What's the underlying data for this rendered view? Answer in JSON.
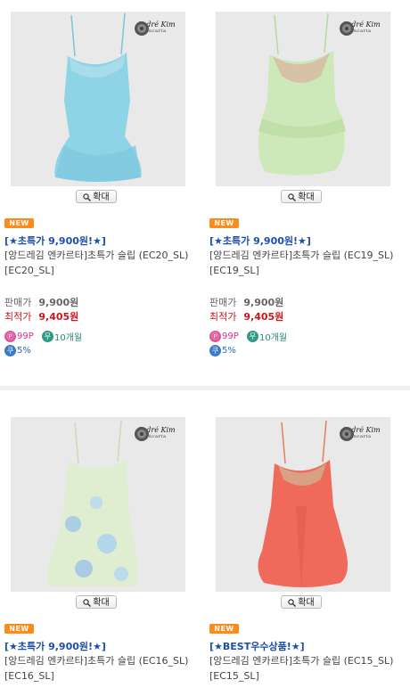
{
  "products": [
    {
      "brand_line1": "André Kim",
      "brand_line2": "encarta",
      "zoom_label": "확대",
      "badge": "NEW",
      "title": "[★초특가 9,900원!★]",
      "description": "[앙드레김 엔카르타]초특가 슬립 (EC20_SL)[EC20_SL]",
      "price_label": "판매가",
      "price_value": "9,900원",
      "best_label": "최적가",
      "best_value": "9,405원",
      "point_icon": "Ⓟ",
      "point_value": "99P",
      "installment_icon": "무",
      "installment_value": "10개월",
      "discount_icon": "쿠",
      "discount_value": "5%",
      "dress_color": "#8fd3e6"
    },
    {
      "brand_line1": "André Kim",
      "brand_line2": "encarta",
      "zoom_label": "확대",
      "badge": "NEW",
      "title": "[★초특가 9,900원!★]",
      "description": "[앙드레김 엔카르타]초특가 슬립 (EC19_SL)[EC19_SL]",
      "price_label": "판매가",
      "price_value": "9,900원",
      "best_label": "최적가",
      "best_value": "9,405원",
      "point_icon": "Ⓟ",
      "point_value": "99P",
      "installment_icon": "무",
      "installment_value": "10개월",
      "discount_icon": "쿠",
      "discount_value": "5%",
      "dress_color": "#cde8b9"
    },
    {
      "brand_line1": "André Kim",
      "brand_line2": "encarta",
      "zoom_label": "확대",
      "badge": "NEW",
      "title": "[★초특가 9,900원!★]",
      "description": "[앙드레김 엔카르타]초특가 슬립 (EC16_SL)[EC16_SL]",
      "dress_color": "#dfeed1"
    },
    {
      "brand_line1": "André Kim",
      "brand_line2": "encarta",
      "zoom_label": "확대",
      "badge": "NEW",
      "title": "[★BEST우수상품!★]",
      "description": "[앙드레김 엔카르타]초특가 슬립 (EC15_SL)[EC15_SL]",
      "dress_color": "#ef6a5a"
    }
  ]
}
